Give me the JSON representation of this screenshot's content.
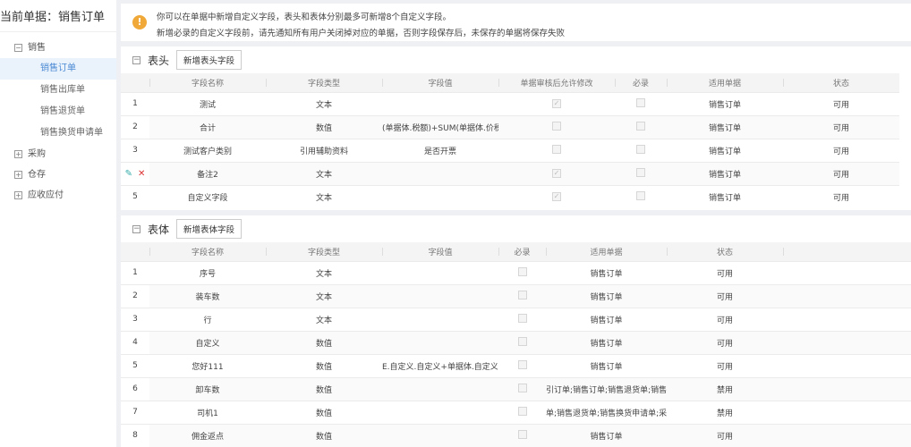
{
  "sidebar": {
    "current": "当前单据：销售订单",
    "groups": [
      {
        "label": "销售",
        "expanded": true,
        "items": [
          "销售订单",
          "销售出库单",
          "销售退货单",
          "销售换货申请单"
        ]
      },
      {
        "label": "采购"
      },
      {
        "label": "仓存"
      },
      {
        "label": "应收应付"
      }
    ]
  },
  "notice": {
    "line1": "你可以在单据中新增自定义字段，表头和表体分别最多可新增8个自定义字段。",
    "line2": "新增必录的自定义字段前，请先通知所有用户关闭掉对应的单据，否则字段保存后，未保存的单据将保存失败"
  },
  "header_section": {
    "title": "表头",
    "add_button": "新增表头字段",
    "columns": [
      "",
      "字段名称",
      "字段类型",
      "字段值",
      "单据审核后允许修改",
      "必录",
      "适用单据",
      "状态"
    ],
    "rows": [
      {
        "idx": "1",
        "name": "测试",
        "type": "文本",
        "value": "",
        "editable": true,
        "required": false,
        "doc": "销售订单",
        "status": "可用"
      },
      {
        "idx": "2",
        "name": "合计",
        "type": "数值",
        "value": "(单据体.税额)+SUM(单据体.价税",
        "editable": false,
        "required": false,
        "doc": "销售订单",
        "status": "可用"
      },
      {
        "idx": "3",
        "name": "测试客户类别",
        "type": "引用辅助资料",
        "value": "是否开票",
        "editable": false,
        "required": false,
        "doc": "销售订单",
        "status": "可用"
      },
      {
        "idx": "",
        "name": "备注2",
        "type": "文本",
        "value": "",
        "editable": true,
        "required": false,
        "doc": "销售订单",
        "status": "可用",
        "hover": true
      },
      {
        "idx": "5",
        "name": "自定义字段",
        "type": "文本",
        "value": "",
        "editable": true,
        "required": false,
        "doc": "销售订单",
        "status": "可用"
      }
    ]
  },
  "body_section": {
    "title": "表体",
    "add_button": "新增表体字段",
    "columns": [
      "",
      "字段名称",
      "字段类型",
      "字段值",
      "必录",
      "适用单据",
      "状态",
      ""
    ],
    "rows": [
      {
        "idx": "1",
        "name": "序号",
        "type": "文本",
        "value": "",
        "doc": "销售订单",
        "status": "可用"
      },
      {
        "idx": "2",
        "name": "装车数",
        "type": "文本",
        "value": "",
        "doc": "销售订单",
        "status": "可用"
      },
      {
        "idx": "3",
        "name": "行",
        "type": "文本",
        "value": "",
        "doc": "销售订单",
        "status": "可用"
      },
      {
        "idx": "4",
        "name": "自定义",
        "type": "数值",
        "value": "",
        "doc": "销售订单",
        "status": "可用"
      },
      {
        "idx": "5",
        "name": "您好111",
        "type": "数值",
        "value": "E.自定义.自定义+单据体.自定义.E",
        "doc": "销售订单",
        "status": "可用"
      },
      {
        "idx": "6",
        "name": "卸车数",
        "type": "数值",
        "value": "",
        "doc": "引订单;销售订单;销售退货单;销售i",
        "status": "禁用"
      },
      {
        "idx": "7",
        "name": "司机1",
        "type": "数值",
        "value": "",
        "doc": "单;销售退货单;销售换货申请单;采",
        "status": "禁用"
      },
      {
        "idx": "8",
        "name": "佣金返点",
        "type": "数值",
        "value": "",
        "doc": "销售订单",
        "status": "可用"
      }
    ]
  }
}
